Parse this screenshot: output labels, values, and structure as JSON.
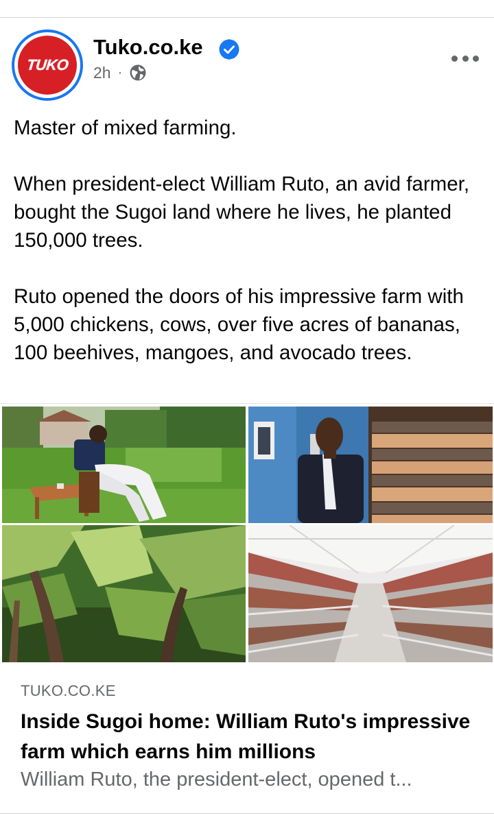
{
  "post": {
    "page_name": "Tuko.co.ke",
    "avatar_text": "TUKO",
    "time": "2h",
    "separator": "·",
    "paragraphs": [
      "Master of mixed farming.",
      "When president-elect William Ruto, an avid farmer, bought the Sugoi land where he lives, he planted 150,000 trees.",
      "Ruto opened the doors of his impressive farm with 5,000 chickens, cows, over five acres of bananas, 100 beehives, mangoes, and avocado trees."
    ]
  },
  "icons": {
    "verified": "verified-badge-icon",
    "audience": "globe-icon",
    "more": "more-options-icon"
  },
  "colors": {
    "brand_blue": "#1877f2",
    "tuko_red": "#d71f26",
    "secondary_text": "#65676b"
  },
  "link_preview": {
    "domain": "TUKO.CO.KE",
    "title": "Inside Sugoi home: William Ruto's impressive farm which earns him millions",
    "description": "William Ruto, the president-elect, opened t..."
  }
}
